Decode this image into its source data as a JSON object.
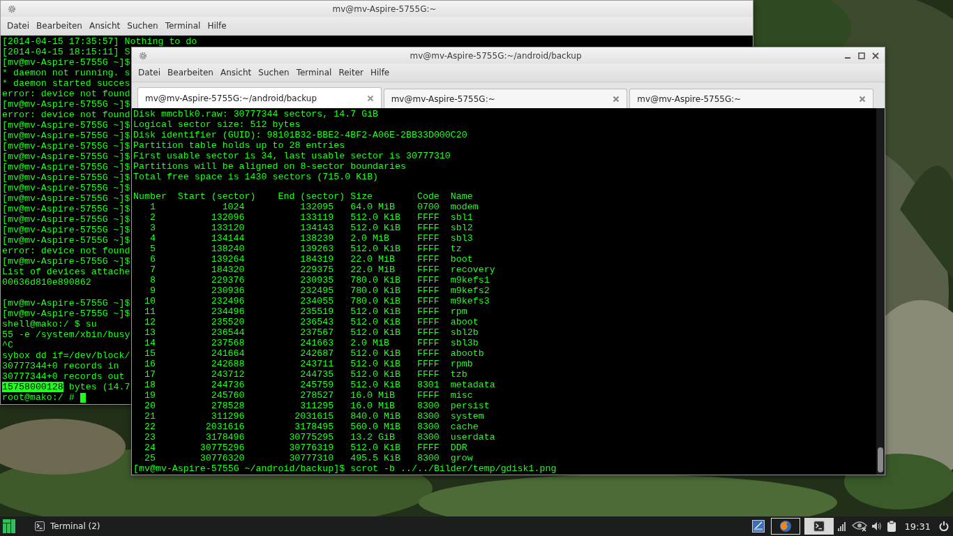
{
  "back_window": {
    "title": "mv@mv-Aspire-5755G:~",
    "menu": [
      "Datei",
      "Bearbeiten",
      "Ansicht",
      "Suchen",
      "Terminal",
      "Hilfe"
    ],
    "lines": [
      "[2014-04-15 17:35:57] Nothing to do",
      "[2014-04-15 18:15:11] S",
      "[mv@mv-Aspire-5755G ~]$",
      "* daemon not running. s",
      "* daemon started succes",
      "error: device not found",
      "[mv@mv-Aspire-5755G ~]$",
      "error: device not found",
      "[mv@mv-Aspire-5755G ~]$",
      "[mv@mv-Aspire-5755G ~]$",
      "[mv@mv-Aspire-5755G ~]$",
      "[mv@mv-Aspire-5755G ~]$",
      "[mv@mv-Aspire-5755G ~]$",
      "[mv@mv-Aspire-5755G ~]$",
      "[mv@mv-Aspire-5755G ~]$",
      "[mv@mv-Aspire-5755G ~]$",
      "[mv@mv-Aspire-5755G ~]$",
      "[mv@mv-Aspire-5755G ~]$",
      "[mv@mv-Aspire-5755G ~]$",
      "[mv@mv-Aspire-5755G ~]$",
      "error: device not found",
      "[mv@mv-Aspire-5755G ~]$",
      "List of devices attache",
      "00636d810e890862"
    ],
    "lines_after_gap": [
      "[mv@mv-Aspire-5755G ~]$",
      "[mv@mv-Aspire-5755G ~]$",
      "shell@mako:/ $ su",
      "55 -e /system/xbin/busy",
      "^C",
      "sybox dd if=/dev/block/",
      "30777344+0 records in",
      "30777344+0 records out"
    ],
    "selection_line": {
      "highlight": "15758000128",
      "text": " bytes (14.7"
    },
    "prompt": {
      "text": "root@mako:/ # ",
      "cursor": true
    }
  },
  "front_window": {
    "title": "mv@mv-Aspire-5755G:~/android/backup",
    "menu": [
      "Datei",
      "Bearbeiten",
      "Ansicht",
      "Suchen",
      "Terminal",
      "Reiter",
      "Hilfe"
    ],
    "tabs": [
      {
        "label": "mv@mv-Aspire-5755G:~/android/backup",
        "selected": true
      },
      {
        "label": "mv@mv-Aspire-5755G:~",
        "selected": false
      },
      {
        "label": "mv@mv-Aspire-5755G:~",
        "selected": false
      }
    ],
    "info_lines": [
      "Disk mmcblk0.raw: 30777344 sectors, 14.7 GiB",
      "Logical sector size: 512 bytes",
      "Disk identifier (GUID): 98101B32-BBE2-4BF2-A06E-2BB33D000C20",
      "Partition table holds up to 28 entries",
      "First usable sector is 34, last usable sector is 30777310",
      "Partitions will be aligned on 8-sector boundaries",
      "Total free space is 1430 sectors (715.0 KiB)"
    ],
    "partition_table": {
      "columns": [
        "Number",
        "Start (sector)",
        "End (sector)",
        "Size",
        "Code",
        "Name"
      ],
      "rows": [
        [
          "1",
          "1024",
          "132095",
          "64.0 MiB",
          "0700",
          "modem"
        ],
        [
          "2",
          "132096",
          "133119",
          "512.0 KiB",
          "FFFF",
          "sbl1"
        ],
        [
          "3",
          "133120",
          "134143",
          "512.0 KiB",
          "FFFF",
          "sbl2"
        ],
        [
          "4",
          "134144",
          "138239",
          "2.0 MiB",
          "FFFF",
          "sbl3"
        ],
        [
          "5",
          "138240",
          "139263",
          "512.0 KiB",
          "FFFF",
          "tz"
        ],
        [
          "6",
          "139264",
          "184319",
          "22.0 MiB",
          "FFFF",
          "boot"
        ],
        [
          "7",
          "184320",
          "229375",
          "22.0 MiB",
          "FFFF",
          "recovery"
        ],
        [
          "8",
          "229376",
          "230935",
          "780.0 KiB",
          "FFFF",
          "m9kefs1"
        ],
        [
          "9",
          "230936",
          "232495",
          "780.0 KiB",
          "FFFF",
          "m9kefs2"
        ],
        [
          "10",
          "232496",
          "234055",
          "780.0 KiB",
          "FFFF",
          "m9kefs3"
        ],
        [
          "11",
          "234496",
          "235519",
          "512.0 KiB",
          "FFFF",
          "rpm"
        ],
        [
          "12",
          "235520",
          "236543",
          "512.0 KiB",
          "FFFF",
          "aboot"
        ],
        [
          "13",
          "236544",
          "237567",
          "512.0 KiB",
          "FFFF",
          "sbl2b"
        ],
        [
          "14",
          "237568",
          "241663",
          "2.0 MiB",
          "FFFF",
          "sbl3b"
        ],
        [
          "15",
          "241664",
          "242687",
          "512.0 KiB",
          "FFFF",
          "abootb"
        ],
        [
          "16",
          "242688",
          "243711",
          "512.0 KiB",
          "FFFF",
          "rpmb"
        ],
        [
          "17",
          "243712",
          "244735",
          "512.0 KiB",
          "FFFF",
          "tzb"
        ],
        [
          "18",
          "244736",
          "245759",
          "512.0 KiB",
          "8301",
          "metadata"
        ],
        [
          "19",
          "245760",
          "278527",
          "16.0 MiB",
          "FFFF",
          "misc"
        ],
        [
          "20",
          "278528",
          "311295",
          "16.0 MiB",
          "8300",
          "persist"
        ],
        [
          "21",
          "311296",
          "2031615",
          "840.0 MiB",
          "8300",
          "system"
        ],
        [
          "22",
          "2031616",
          "3178495",
          "560.0 MiB",
          "8300",
          "cache"
        ],
        [
          "23",
          "3178496",
          "30775295",
          "13.2 GiB",
          "8300",
          "userdata"
        ],
        [
          "24",
          "30775296",
          "30776319",
          "512.0 KiB",
          "FFFF",
          "DDR"
        ],
        [
          "25",
          "30776320",
          "30777310",
          "495.5 KiB",
          "8300",
          "grow"
        ]
      ]
    },
    "prompt_line": "[mv@mv-Aspire-5755G ~/android/backup]$ scrot -b ../../Bilder/temp/gdisk1.png"
  },
  "taskbar": {
    "tasks": [
      {
        "label": "Terminal (2)"
      }
    ],
    "launchers": [
      {
        "kind": "image-viewer",
        "selected": false
      },
      {
        "kind": "browser",
        "selected": false
      },
      {
        "kind": "terminal",
        "selected": true
      }
    ],
    "clock": "19:31"
  }
}
